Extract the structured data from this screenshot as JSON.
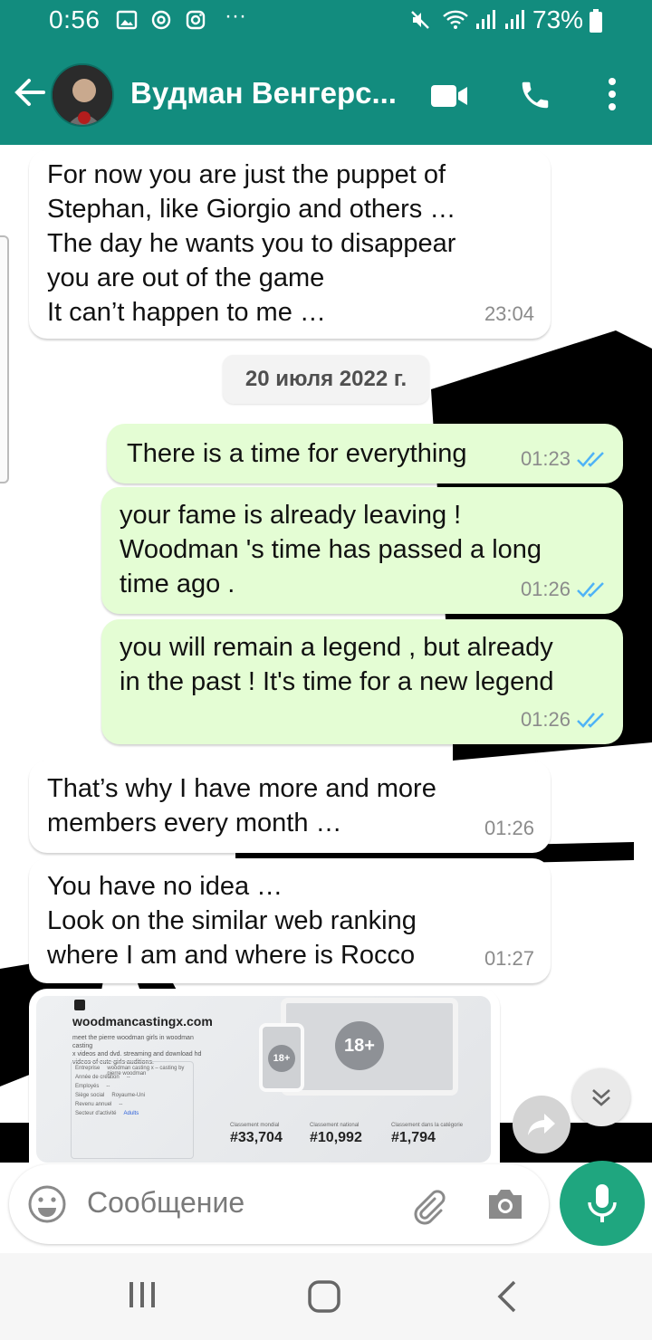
{
  "status_bar": {
    "time": "0:56",
    "more": "···",
    "battery": "73%"
  },
  "header": {
    "contact_name": "Вудман Венгерс...",
    "colors": {
      "bar": "#128c7e",
      "text": "#ffffff"
    }
  },
  "messages": [
    {
      "direction": "incoming",
      "text": "For now you are just the puppet of\nStephan, like Giorgio and others …\nThe day he wants you to disappear\nyou are out of the game\nIt can’t happen to me …",
      "time": "23:04"
    },
    {
      "direction": "outgoing",
      "text": "There is a time for everything",
      "time": "01:23",
      "status": "read"
    },
    {
      "direction": "outgoing",
      "text": "your fame is already leaving !\nWoodman 's time has passed a long\ntime ago .",
      "time": "01:26",
      "status": "read"
    },
    {
      "direction": "outgoing",
      "text": "you will remain a legend , but already\nin the past ! It's time for a new legend",
      "time": "01:26",
      "status": "read"
    },
    {
      "direction": "incoming",
      "text": "That’s why I have more and more\nmembers every month …",
      "time": "01:26"
    },
    {
      "direction": "incoming",
      "text": "You have no idea …\nLook on the similar web ranking\nwhere I am and where is Rocco",
      "time": "01:27"
    }
  ],
  "date_separator": "20 июля 2022 г.",
  "link_preview": {
    "site": "woodmancastingx.com",
    "description": "meet the pierre woodman girls in woodman casting\nx videos and dvd. streaming and download hd\nvideos of cute girls auditions.",
    "table_rows": [
      {
        "k": "Entreprise",
        "v": "woodman casting x – casting by pierre woodman"
      },
      {
        "k": "Année de création",
        "v": "--"
      },
      {
        "k": "Employés",
        "v": "--"
      },
      {
        "k": "Siège social",
        "v": "Royaume-Uni"
      },
      {
        "k": "Revenu annuel",
        "v": "--"
      },
      {
        "k": "Secteur d'activité",
        "v": "Adults"
      }
    ],
    "badge": "18+",
    "stats": [
      {
        "label": "Classement mondial",
        "value": "#33,704"
      },
      {
        "label": "Classement national",
        "value": "#10,992"
      },
      {
        "label": "Classement dans la catégorie",
        "value": "#1,794"
      }
    ]
  },
  "composer": {
    "placeholder": "Сообщение"
  },
  "colors": {
    "incoming_bubble": "#ffffff",
    "outgoing_bubble": "#e4fdd4",
    "read_ticks": "#4fb3f6",
    "mic_button": "#1fa67f"
  }
}
